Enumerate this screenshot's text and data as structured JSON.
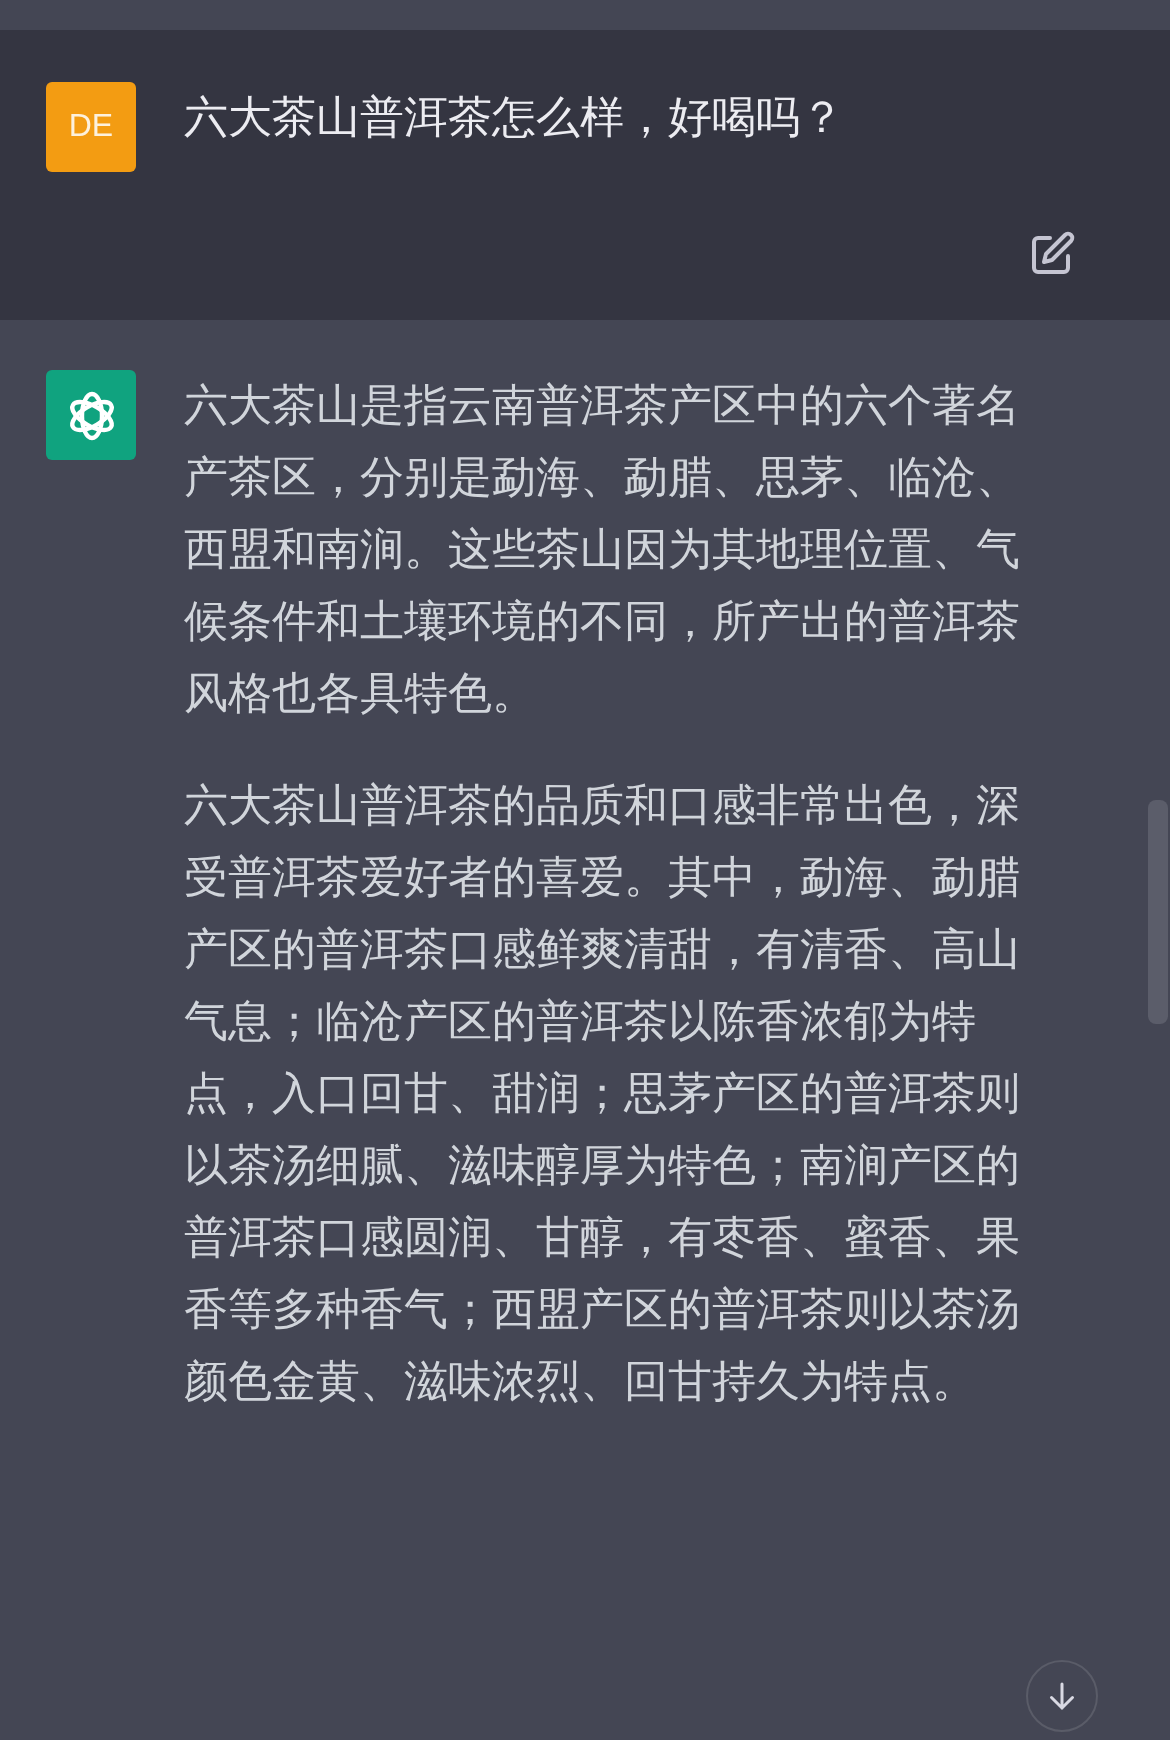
{
  "messages": [
    {
      "kind": "user",
      "avatar": "DE",
      "text": "六大茶山普洱茶怎么样，好喝吗？"
    },
    {
      "kind": "assistant",
      "paragraphs": [
        "六大茶山是指云南普洱茶产区中的六个著名产茶区，分别是勐海、勐腊、思茅、临沧、西盟和南涧。这些茶山因为其地理位置、气候条件和土壤环境的不同，所产出的普洱茶风格也各具特色。",
        "六大茶山普洱茶的品质和口感非常出色，深受普洱茶爱好者的喜爱。其中，勐海、勐腊产区的普洱茶口感鲜爽清甜，有清香、高山气息；临沧产区的普洱茶以陈香浓郁为特点，入口回甘、甜润；思茅产区的普洱茶则以茶汤细腻、滋味醇厚为特色；南涧产区的普洱茶口感圆润、甘醇，有枣香、蜜香、果香等多种香气；西盟产区的普洱茶则以茶汤颜色金黄、滋味浓烈、回甘持久为特点。"
      ]
    }
  ]
}
